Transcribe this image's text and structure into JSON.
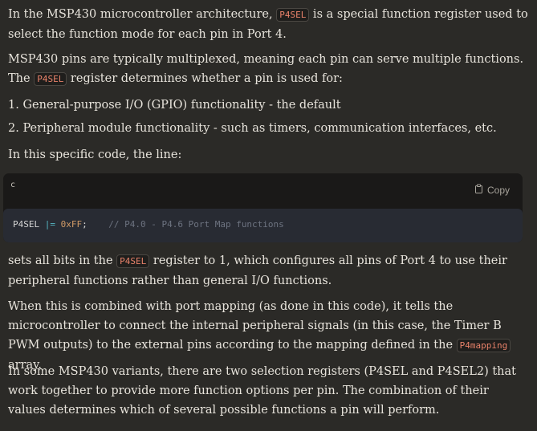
{
  "p1": {
    "before": "In the MSP430 microcontroller architecture, ",
    "code": "P4SEL",
    "after": " is a special function register used to select the function mode for each pin in Port 4."
  },
  "p2": {
    "before": "MSP430 pins are typically multiplexed, meaning each pin can serve multiple functions. The ",
    "code": "P4SEL",
    "after": " register determines whether a pin is used for:"
  },
  "list": [
    "1. General-purpose I/O (GPIO) functionality - the default",
    "2. Peripheral module functionality - such as timers, communication interfaces, etc."
  ],
  "p3": "In this specific code, the line:",
  "code_block": {
    "language": "c",
    "copy_label": "Copy",
    "tokens": {
      "identifier": "P4SEL",
      "operator": "|=",
      "value": "0xFF",
      "semicolon": ";",
      "comment": "// P4.0 - P4.6 Port Map functions"
    }
  },
  "p4": {
    "before": "sets all bits in the ",
    "code": "P4SEL",
    "after": " register to 1, which configures all pins of Port 4 to use their peripheral functions rather than general I/O functions."
  },
  "p5": {
    "before": "When this is combined with port mapping (as done in this code), it tells the microcontroller to connect the internal peripheral signals (in this case, the Timer B PWM outputs) to the external pins according to the mapping defined in the ",
    "code": "P4mapping",
    "after": " array."
  },
  "p6": "In some MSP430 variants, there are two selection registers (P4SEL and P4SEL2) that work together to provide more function options per pin. The combination of their values determines which of several possible functions a pin will perform.",
  "colors": {
    "background": "#2b2a27",
    "text": "#e8e4dc",
    "inline_code": "#e8826a",
    "code_block_bg": "#1a1918",
    "code_body_bg": "#282b33"
  }
}
